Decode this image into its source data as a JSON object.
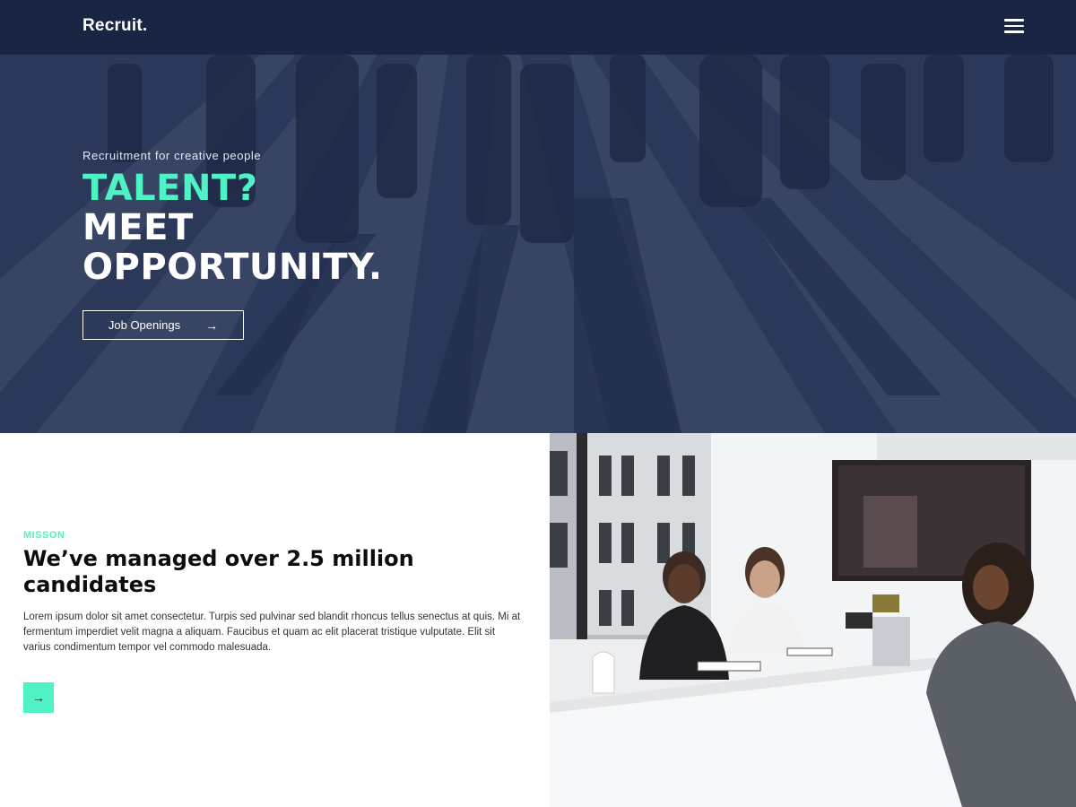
{
  "header": {
    "logo": "Recruit.",
    "menu_icon": "hamburger-menu-icon"
  },
  "hero": {
    "kicker": "Recruitment for creative people",
    "title_line1": "TALENT?",
    "title_line2": "MEET",
    "title_line3": "OPPORTUNITY.",
    "cta_label": "Job Openings",
    "cta_icon": "arrow-right-icon"
  },
  "mission": {
    "kicker": "MISSON",
    "title": "We’ve managed over 2.5 million candidates",
    "body": "Lorem ipsum dolor sit amet consectetur. Turpis sed pulvinar sed blandit rhoncus tellus senectus at quis. Mi at fermentum imperdiet velit magna a aliquam. Faucibus et quam ac elit placerat tristique vulputate. Elit sit varius condimentum tempor vel commodo malesuada.",
    "button_icon": "arrow-right-icon"
  },
  "colors": {
    "navy": "#1a2544",
    "accent": "#4ef2c4",
    "white": "#ffffff",
    "text_dark": "#0d0d0d"
  }
}
